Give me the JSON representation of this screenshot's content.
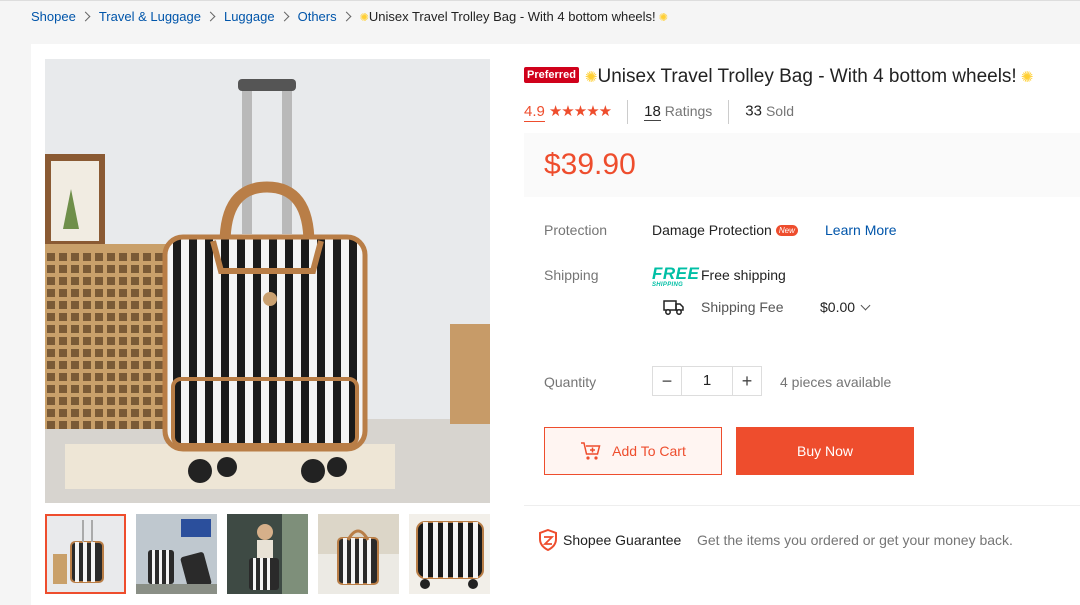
{
  "breadcrumb": {
    "items": [
      "Shopee",
      "Travel & Luggage",
      "Luggage",
      "Others"
    ],
    "current": "Unisex Travel Trolley Bag - With 4 bottom wheels!"
  },
  "product": {
    "preferred_badge": "Preferred",
    "title": "Unisex Travel Trolley Bag - With 4 bottom wheels!",
    "rating": "4.9",
    "stars": 5,
    "ratings_count": "18",
    "ratings_label": "Ratings",
    "sold_count": "33",
    "sold_label": "Sold",
    "price": "$39.90"
  },
  "protection": {
    "label": "Protection",
    "value": "Damage Protection",
    "badge": "New",
    "link": "Learn More"
  },
  "shipping": {
    "label": "Shipping",
    "free_logo_top": "FREE",
    "free_logo_bottom": "SHIPPING",
    "free_text": "Free shipping",
    "fee_label": "Shipping Fee",
    "fee_value": "$0.00"
  },
  "quantity": {
    "label": "Quantity",
    "minus": "−",
    "value": "1",
    "plus": "+",
    "available": "4 pieces available"
  },
  "actions": {
    "add_to_cart": "Add To Cart",
    "buy_now": "Buy Now"
  },
  "guarantee": {
    "title": "Shopee Guarantee",
    "text": "Get the items you ordered or get your money back."
  },
  "colors": {
    "accent": "#ee4d2d",
    "link": "#0055aa",
    "free_shipping": "#00bfa5",
    "preferred": "#d0011b"
  },
  "icons": [
    "chevron-right-icon",
    "sun-icon",
    "star-icon",
    "truck-icon",
    "chevron-down-icon",
    "cart-plus-icon",
    "shield-icon"
  ]
}
